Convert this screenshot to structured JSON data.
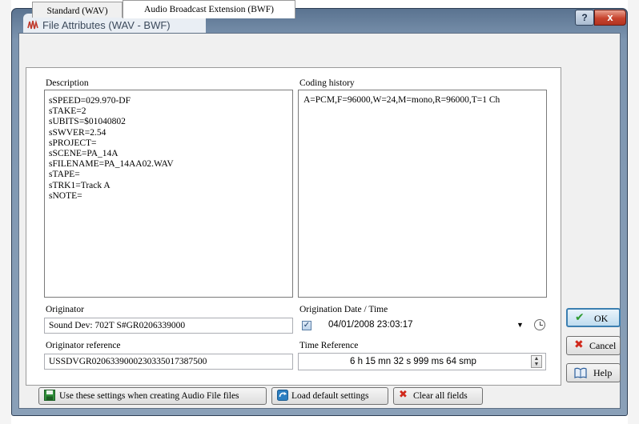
{
  "window": {
    "title": "File Attributes (WAV - BWF)",
    "help_glyph": "?",
    "close_glyph": "x"
  },
  "tabs": [
    {
      "label": "Standard (WAV)",
      "active": false
    },
    {
      "label": "Audio Broadcast Extension (BWF)",
      "active": true
    }
  ],
  "description": {
    "label": "Description",
    "lines": [
      "sSPEED=029.970-DF",
      "sTAKE=2",
      "sUBITS=$01040802",
      "sSWVER=2.54",
      "sPROJECT=",
      "sSCENE=PA_14A",
      "sFILENAME=PA_14AA02.WAV",
      "sTAPE=",
      "sTRK1=Track A",
      "sNOTE="
    ]
  },
  "coding_history": {
    "label": "Coding history",
    "value": "A=PCM,F=96000,W=24,M=mono,R=96000,T=1 Ch"
  },
  "originator": {
    "label": "Originator",
    "value": "Sound Dev: 702T S#GR0206339000"
  },
  "originator_reference": {
    "label": "Originator reference",
    "value": "USSDVGR0206339000230335017387500"
  },
  "origination_datetime": {
    "label": "Origination Date / Time",
    "checked": true,
    "value": "04/01/2008 23:03:17"
  },
  "time_reference": {
    "label": "Time Reference",
    "value": "6 h 15 mn 32 s 999 ms 64 smp"
  },
  "buttons": {
    "ok": "OK",
    "cancel": "Cancel",
    "help": "Help",
    "use_settings": "Use these settings when creating Audio File files",
    "load_default": "Load default settings",
    "clear_all": "Clear all fields"
  },
  "colors": {
    "ok_check": "#2e9a2e",
    "cancel_x": "#d0281b",
    "title_bar": "#7d95b0"
  },
  "icons": {
    "app": "waveform-icon",
    "ok": "checkmark-icon",
    "cancel": "x-icon",
    "help": "book-icon",
    "save": "floppy-disk-icon",
    "load": "refresh-arrow-icon",
    "clear": "x-icon",
    "calendar": "clock-icon"
  }
}
